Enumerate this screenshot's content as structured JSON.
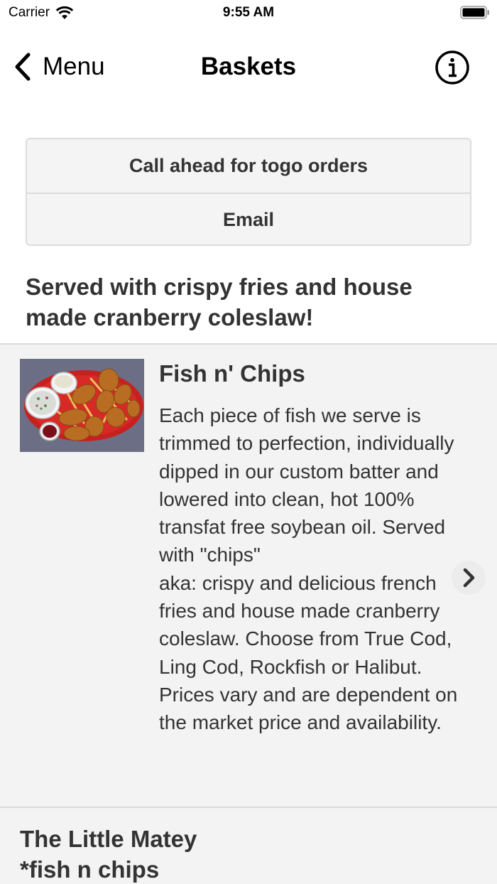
{
  "status": {
    "carrier": "Carrier",
    "time": "9:55 AM"
  },
  "nav": {
    "back_label": "Menu",
    "title": "Baskets"
  },
  "actions": [
    {
      "label": "Call ahead for togo orders"
    },
    {
      "label": "Email"
    }
  ],
  "intro": "Served with crispy fries and house made cranberry coleslaw!",
  "items": [
    {
      "title": "Fish n' Chips",
      "description": "Each piece of fish we serve is trimmed to perfection, individually dipped in our custom batter and lowered into clean, hot 100% transfat free soybean oil. Served with \"chips\"\naka: crispy and delicious french fries and house made cranberry coleslaw. Choose from True Cod, Ling Cod, Rockfish or Halibut. Prices vary and are dependent on the market price and availability."
    },
    {
      "title": "The Little Matey\n*fish n chips"
    }
  ],
  "icons": {
    "back": "chevron-left-icon",
    "info": "info-circle-icon",
    "disclosure": "chevron-right-icon"
  }
}
